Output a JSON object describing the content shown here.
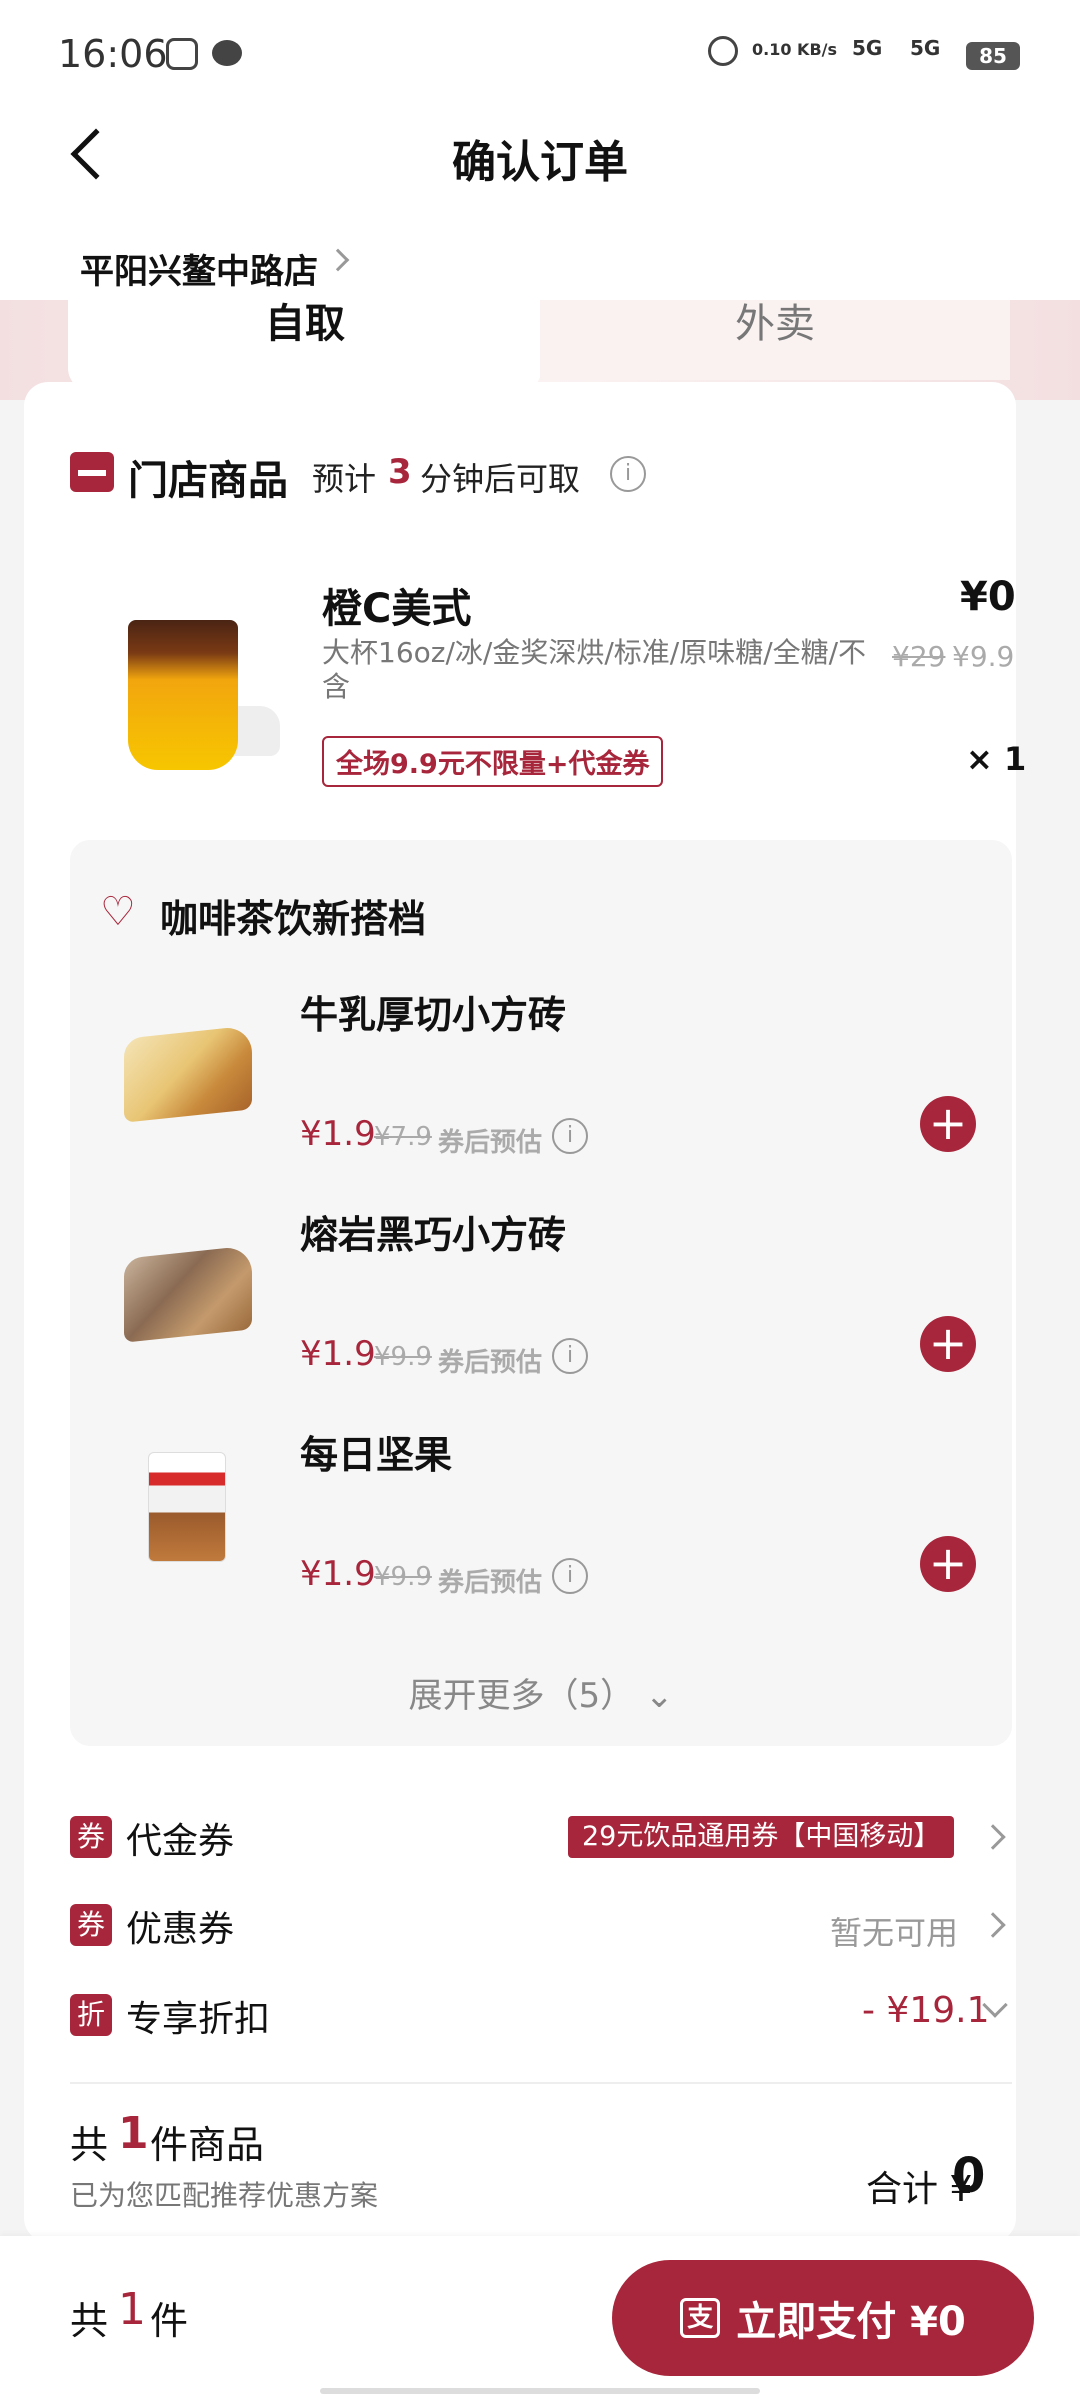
{
  "status_bar": {
    "time": "16:06",
    "net_speed": "0.10 KB/s",
    "signal_1": "5G",
    "signal_2": "5G",
    "battery": "85"
  },
  "header": {
    "title": "确认订单",
    "store": "平阳兴鳌中路店"
  },
  "tabs": [
    {
      "label": "自取",
      "active": true
    },
    {
      "label": "外卖",
      "active": false
    }
  ],
  "store_section": {
    "title": "门店商品",
    "pickup_pre": "预计",
    "pickup_minutes": "3",
    "pickup_post": "分钟后可取"
  },
  "product": {
    "name": "橙C美式",
    "price": "¥0",
    "description": "大杯16oz/冰/金奖深烘/标准/原味糖/全糖/不含",
    "original_price": "¥29",
    "promo_price": "¥9.9",
    "promo_tag": "全场9.9元不限量+代金券",
    "quantity": "× 1"
  },
  "combo": {
    "title": "咖啡茶饮新搭档",
    "items": [
      {
        "name": "牛乳厚切小方砖",
        "price": "¥1.9",
        "original": "¥7.9",
        "note": "券后预估"
      },
      {
        "name": "熔岩黑巧小方砖",
        "price": "¥1.9",
        "original": "¥9.9",
        "note": "券后预估"
      },
      {
        "name": "每日坚果",
        "price": "¥1.9",
        "original": "¥9.9",
        "note": "券后预估"
      }
    ],
    "expand_label": "展开更多（5）"
  },
  "rows": {
    "voucher": {
      "badge": "券",
      "label": "代金券",
      "value": "29元饮品通用券【中国移动】"
    },
    "coupon": {
      "badge": "券",
      "label": "优惠券",
      "value": "暂无可用"
    },
    "discount": {
      "badge": "折",
      "label": "专享折扣",
      "value": "- ¥19.1"
    }
  },
  "summary": {
    "count_pre": "共",
    "count": "1",
    "count_post": "件商品",
    "note": "已为您匹配推荐优惠方案",
    "total_label": "合计 ¥",
    "total_value": "0"
  },
  "bottom_bar": {
    "count_pre": "共",
    "count": "1",
    "count_post": "件",
    "pay_icon": "支",
    "pay_label": "立即支付 ¥0"
  },
  "colors": {
    "accent": "#a8263b"
  }
}
